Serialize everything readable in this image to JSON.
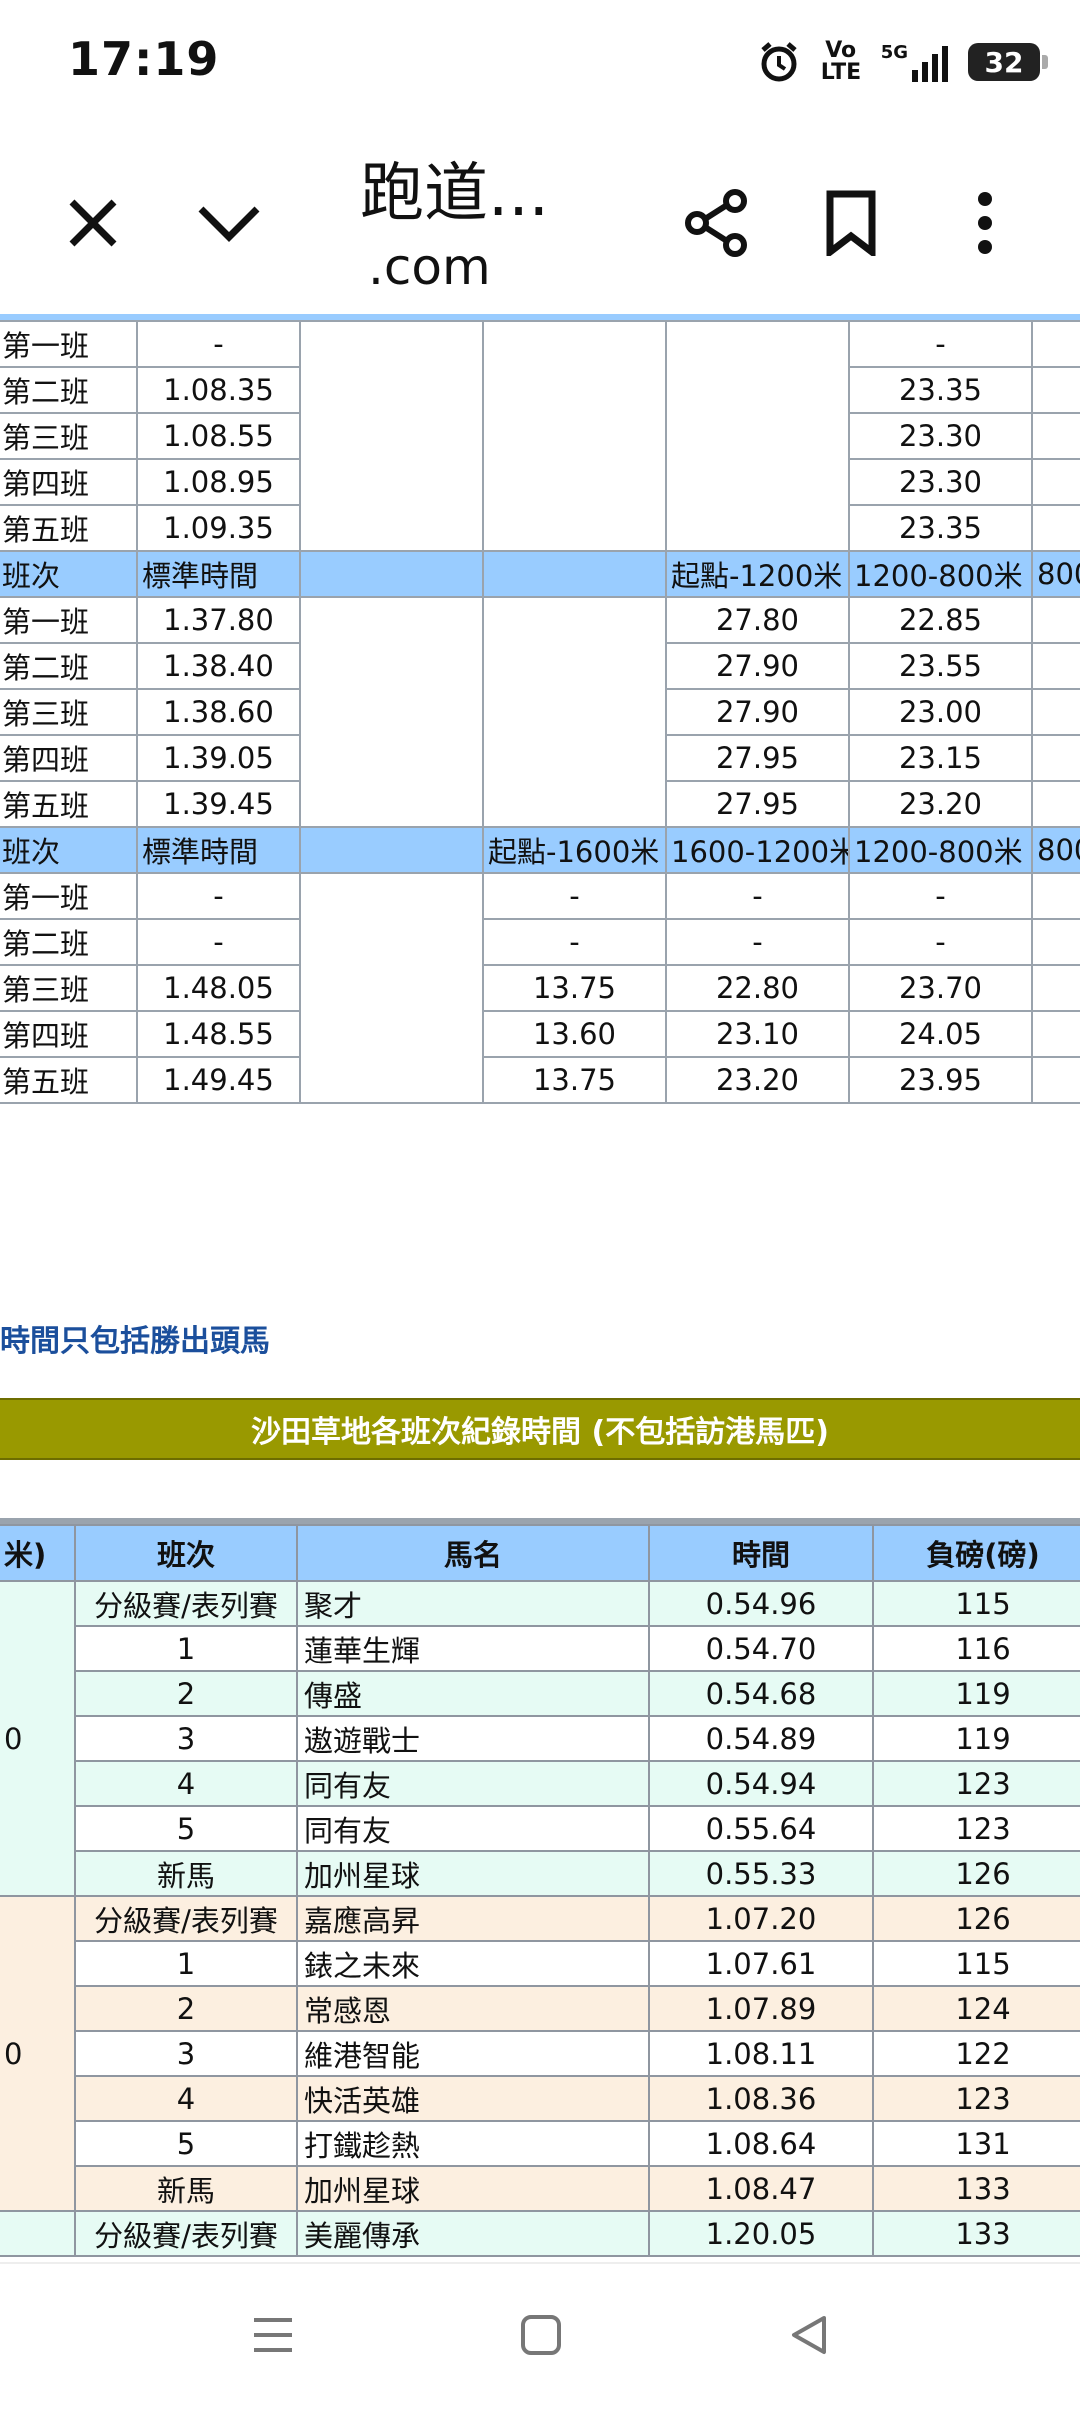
{
  "status_bar": {
    "time": "17:19",
    "network": "Vo LTE",
    "signal": "5G",
    "battery": "32"
  },
  "toolbar": {
    "title": "跑道...",
    "domain": ".com"
  },
  "table_a": {
    "rows": [
      [
        "第一班",
        "-",
        "-"
      ],
      [
        "第二班",
        "1.08.35",
        "23.35"
      ],
      [
        "第三班",
        "1.08.55",
        "23.30"
      ],
      [
        "第四班",
        "1.08.95",
        "23.30"
      ],
      [
        "第五班",
        "1.09.35",
        "23.35"
      ]
    ]
  },
  "table_b": {
    "header": [
      "班次",
      "標準時間",
      "",
      "",
      "起點-1200米",
      "1200-800米",
      "800"
    ],
    "rows": [
      [
        "第一班",
        "1.37.80",
        "27.80",
        "22.85"
      ],
      [
        "第二班",
        "1.38.40",
        "27.90",
        "23.55"
      ],
      [
        "第三班",
        "1.38.60",
        "27.90",
        "23.00"
      ],
      [
        "第四班",
        "1.39.05",
        "27.95",
        "23.15"
      ],
      [
        "第五班",
        "1.39.45",
        "27.95",
        "23.20"
      ]
    ]
  },
  "table_c": {
    "header": [
      "班次",
      "標準時間",
      "",
      "起點-1600米",
      "1600-1200米",
      "1200-800米",
      "800"
    ],
    "rows": [
      [
        "第一班",
        "-",
        "-",
        "-",
        "-"
      ],
      [
        "第二班",
        "-",
        "-",
        "-",
        "-"
      ],
      [
        "第三班",
        "1.48.05",
        "13.75",
        "22.80",
        "23.70"
      ],
      [
        "第四班",
        "1.48.55",
        "13.60",
        "23.10",
        "24.05"
      ],
      [
        "第五班",
        "1.49.45",
        "13.75",
        "23.20",
        "23.95"
      ]
    ]
  },
  "note": "時間只包括勝出頭馬",
  "records_title": "沙田草地各班次紀錄時間 (不包括訪港馬匹)",
  "records": {
    "headers": [
      "米)",
      "班次",
      "馬名",
      "時間",
      "負磅(磅)"
    ],
    "group1_label": "0",
    "group1": [
      [
        "分級賽/表列賽",
        "聚才",
        "0.54.96",
        "115"
      ],
      [
        "1",
        "蓮華生輝",
        "0.54.70",
        "116"
      ],
      [
        "2",
        "傳盛",
        "0.54.68",
        "119"
      ],
      [
        "3",
        "遨遊戰士",
        "0.54.89",
        "119"
      ],
      [
        "4",
        "同有友",
        "0.54.94",
        "123"
      ],
      [
        "5",
        "同有友",
        "0.55.64",
        "123"
      ],
      [
        "新馬",
        "加州星球",
        "0.55.33",
        "126"
      ]
    ],
    "group2_label": "0",
    "group2": [
      [
        "分級賽/表列賽",
        "嘉應高昇",
        "1.07.20",
        "126"
      ],
      [
        "1",
        "錶之未來",
        "1.07.61",
        "115"
      ],
      [
        "2",
        "常感恩",
        "1.07.89",
        "124"
      ],
      [
        "3",
        "維港智能",
        "1.08.11",
        "122"
      ],
      [
        "4",
        "快活英雄",
        "1.08.36",
        "123"
      ],
      [
        "5",
        "打鐵趁熱",
        "1.08.64",
        "131"
      ],
      [
        "新馬",
        "加州星球",
        "1.08.47",
        "133"
      ]
    ],
    "partial_row": [
      "分級賽/表列賽",
      "美麗傳承",
      "1.20.05",
      "133"
    ]
  }
}
